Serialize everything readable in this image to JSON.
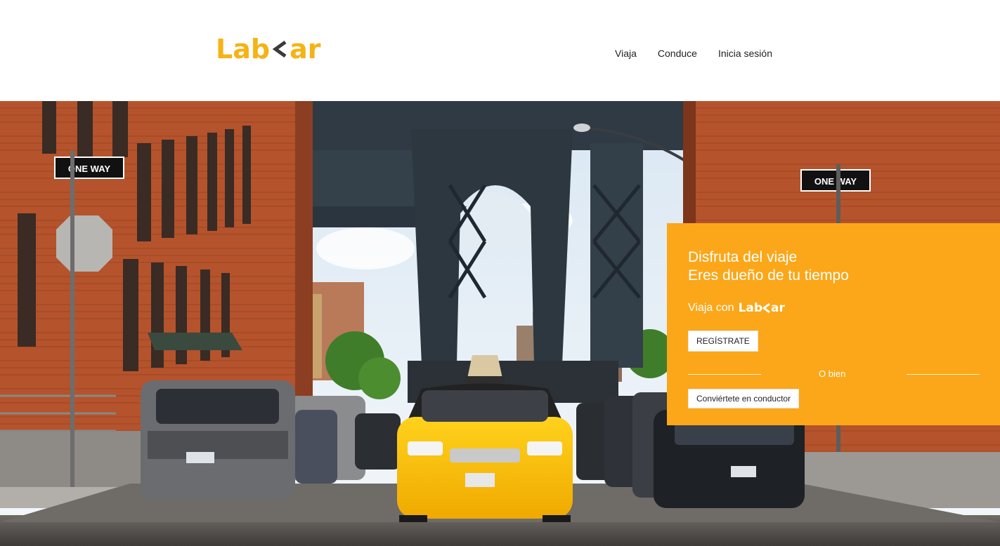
{
  "brand": {
    "name_left": "Lab",
    "name_right": "ar",
    "color": "#f5b315",
    "icon": "chevron-left-icon"
  },
  "nav": {
    "items": [
      {
        "label": "Viaja"
      },
      {
        "label": "Conduce"
      },
      {
        "label": "Inicia sesión"
      }
    ]
  },
  "hero": {
    "image": "city-street-taxi-bridge-photo"
  },
  "promo": {
    "line1": "Disfruta del viaje",
    "line2": "Eres dueño de tu tiempo",
    "ride_with": "Viaja con",
    "register_label": "REGÍSTRATE",
    "or_label": "O bien",
    "driver_label": "Conviértete en conductor",
    "background": "#fba719"
  },
  "scene_signs": {
    "one_way_left": "ONE WAY",
    "one_way_right": "ONE WAY"
  }
}
